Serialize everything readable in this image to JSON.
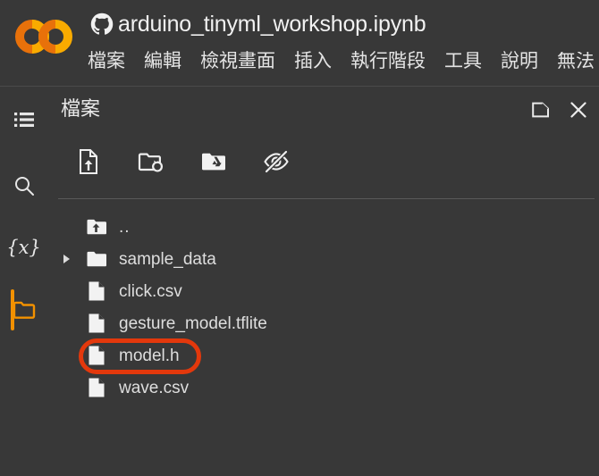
{
  "window": {
    "app": "Google Colaboratory",
    "background_color": "#383838",
    "accent_color": "#f29100",
    "highlight_color": "#e3380c"
  },
  "topbar": {
    "logo_name": "colab-logo",
    "github_icon_name": "github-icon",
    "document_title": "arduino_tinyml_workshop.ipynb",
    "menu": [
      {
        "label": "檔案",
        "name": "menu-file"
      },
      {
        "label": "編輯",
        "name": "menu-edit"
      },
      {
        "label": "檢視畫面",
        "name": "menu-view"
      },
      {
        "label": "插入",
        "name": "menu-insert"
      },
      {
        "label": "執行階段",
        "name": "menu-runtime"
      },
      {
        "label": "工具",
        "name": "menu-tools"
      },
      {
        "label": "說明",
        "name": "menu-help"
      },
      {
        "label": "無法",
        "name": "menu-status-truncated"
      }
    ]
  },
  "rail": {
    "items": [
      {
        "icon": "list-icon",
        "name": "rail-toggle-sidebar",
        "active": false
      },
      {
        "icon": "search-icon",
        "name": "rail-search",
        "active": false
      },
      {
        "icon": "variables-icon",
        "glyph": "{x}",
        "name": "rail-variables",
        "active": false
      },
      {
        "icon": "folder-icon",
        "name": "rail-files",
        "active": true
      }
    ]
  },
  "panel": {
    "title": "檔案",
    "actions": [
      {
        "icon": "new-window-icon",
        "name": "open-in-new-window-button"
      },
      {
        "icon": "close-icon",
        "name": "close-panel-button"
      }
    ],
    "toolbar": [
      {
        "icon": "upload-file-icon",
        "name": "upload-to-session-storage-button"
      },
      {
        "icon": "refresh-folder-icon",
        "name": "refresh-files-button"
      },
      {
        "icon": "mount-drive-icon",
        "name": "mount-google-drive-button"
      },
      {
        "icon": "eye-off-icon",
        "name": "toggle-hidden-files-button"
      }
    ],
    "files": [
      {
        "name": "..",
        "type": "parent",
        "icon": "folder-up-icon",
        "expandable": false,
        "highlighted": false
      },
      {
        "name": "sample_data",
        "type": "folder",
        "icon": "folder-icon",
        "expandable": true,
        "highlighted": false
      },
      {
        "name": "click.csv",
        "type": "file",
        "icon": "file-icon",
        "expandable": false,
        "highlighted": false
      },
      {
        "name": "gesture_model.tflite",
        "type": "file",
        "icon": "file-icon",
        "expandable": false,
        "highlighted": false
      },
      {
        "name": "model.h",
        "type": "file",
        "icon": "file-icon",
        "expandable": false,
        "highlighted": true
      },
      {
        "name": "wave.csv",
        "type": "file",
        "icon": "file-icon",
        "expandable": false,
        "highlighted": false
      }
    ]
  }
}
